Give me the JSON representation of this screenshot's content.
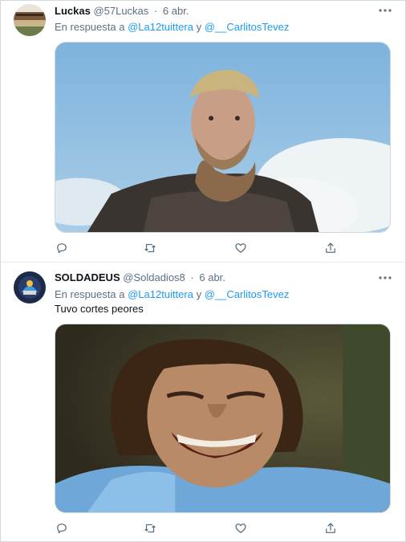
{
  "tweets": [
    {
      "display_name": "Luckas",
      "handle": "@57Luckas",
      "separator": "·",
      "date": "6 abr.",
      "reply_prefix": "En respuesta a",
      "mention_1": "@La12tuittera",
      "conjunction": "y",
      "mention_2": "@__CarlitosTevez",
      "text": "",
      "media_description_icon": "image"
    },
    {
      "display_name": "SOLDADEUS",
      "handle": "@Soldadios8",
      "separator": "·",
      "date": "6 abr.",
      "reply_prefix": "En respuesta a",
      "mention_1": "@La12tuittera",
      "conjunction": "y",
      "mention_2": "@__CarlitosTevez",
      "text": "Tuvo cortes peores",
      "media_description_icon": "image"
    }
  ],
  "icons": {
    "reply": "reply-icon",
    "retweet": "retweet-icon",
    "like": "heart-icon",
    "share": "share-icon",
    "more": "more-icon"
  },
  "colors": {
    "link": "#1d9bf0",
    "muted": "#5b7083",
    "border": "#cfd9de"
  }
}
